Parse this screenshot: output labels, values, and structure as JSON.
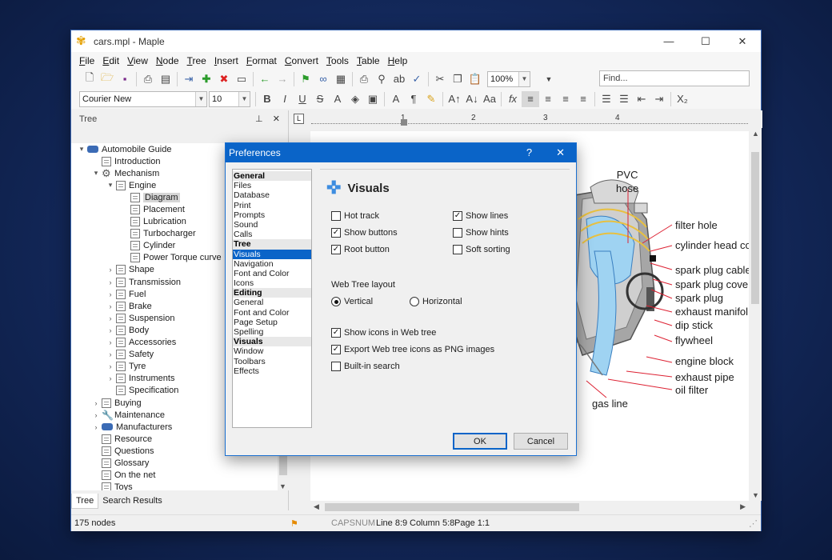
{
  "window": {
    "title": "cars.mpl - Maple"
  },
  "menu": [
    "File",
    "Edit",
    "View",
    "Node",
    "Tree",
    "Insert",
    "Format",
    "Convert",
    "Tools",
    "Table",
    "Help"
  ],
  "toolbar": {
    "zoom": "100%",
    "find_placeholder": "Find...",
    "font": "Courier New",
    "font_size": "10"
  },
  "tree_panel": {
    "title": "Tree",
    "rows": [
      {
        "label": "Automobile Guide",
        "indent": 0,
        "exp": "▾",
        "icon": "car"
      },
      {
        "label": "Introduction",
        "indent": 1,
        "exp": "",
        "icon": "page"
      },
      {
        "label": "Mechanism",
        "indent": 1,
        "exp": "▾",
        "icon": "gear"
      },
      {
        "label": "Engine",
        "indent": 2,
        "exp": "▾",
        "icon": "page"
      },
      {
        "label": "Diagram",
        "indent": 3,
        "exp": "",
        "icon": "page",
        "selected": true
      },
      {
        "label": "Placement",
        "indent": 3,
        "exp": "",
        "icon": "page"
      },
      {
        "label": "Lubrication",
        "indent": 3,
        "exp": "",
        "icon": "page"
      },
      {
        "label": "Turbocharger",
        "indent": 3,
        "exp": "",
        "icon": "page"
      },
      {
        "label": "Cylinder",
        "indent": 3,
        "exp": "",
        "icon": "page"
      },
      {
        "label": "Power Torque curve",
        "indent": 3,
        "exp": "",
        "icon": "page"
      },
      {
        "label": "Shape",
        "indent": 2,
        "exp": "›",
        "icon": "page"
      },
      {
        "label": "Transmission",
        "indent": 2,
        "exp": "›",
        "icon": "page"
      },
      {
        "label": "Fuel",
        "indent": 2,
        "exp": "›",
        "icon": "page"
      },
      {
        "label": "Brake",
        "indent": 2,
        "exp": "›",
        "icon": "page"
      },
      {
        "label": "Suspension",
        "indent": 2,
        "exp": "›",
        "icon": "page"
      },
      {
        "label": "Body",
        "indent": 2,
        "exp": "›",
        "icon": "page"
      },
      {
        "label": "Accessories",
        "indent": 2,
        "exp": "›",
        "icon": "page"
      },
      {
        "label": "Safety",
        "indent": 2,
        "exp": "›",
        "icon": "page"
      },
      {
        "label": "Tyre",
        "indent": 2,
        "exp": "›",
        "icon": "page"
      },
      {
        "label": "Instruments",
        "indent": 2,
        "exp": "›",
        "icon": "page"
      },
      {
        "label": "Specification",
        "indent": 2,
        "exp": "",
        "icon": "page"
      },
      {
        "label": "Buying",
        "indent": 1,
        "exp": "›",
        "icon": "page"
      },
      {
        "label": "Maintenance",
        "indent": 1,
        "exp": "›",
        "icon": "wrench"
      },
      {
        "label": "Manufacturers",
        "indent": 1,
        "exp": "›",
        "icon": "car"
      },
      {
        "label": "Resource",
        "indent": 1,
        "exp": "",
        "icon": "page"
      },
      {
        "label": "Questions",
        "indent": 1,
        "exp": "",
        "icon": "page"
      },
      {
        "label": "Glossary",
        "indent": 1,
        "exp": "",
        "icon": "page"
      },
      {
        "label": "On the net",
        "indent": 1,
        "exp": "",
        "icon": "page"
      },
      {
        "label": "Toys",
        "indent": 1,
        "exp": "",
        "icon": "page"
      }
    ],
    "tabs": [
      "Tree",
      "Search Results"
    ]
  },
  "ruler": {
    "marks": [
      "1",
      "2",
      "3",
      "4"
    ]
  },
  "diagram": {
    "labels": [
      "PVC",
      "hose",
      "filter hole",
      "cylinder head co",
      "spark plug cable",
      "spark plug cove",
      "spark plug",
      "exhaust manifol",
      "dip stick",
      "flywheel",
      "engine block",
      "exhaust pipe",
      "oil filter",
      "gas line"
    ]
  },
  "status": {
    "nodes": "175 nodes",
    "caps": "CAPS",
    "num": "NUM",
    "line": "Line 8:9",
    "column": "Column 5:8",
    "page": "Page 1:1"
  },
  "dialog": {
    "title": "Preferences",
    "help": "?",
    "close": "✕",
    "categories": [
      {
        "label": "General",
        "hdr": true
      },
      {
        "label": "Files"
      },
      {
        "label": "Database"
      },
      {
        "label": "Print"
      },
      {
        "label": "Prompts"
      },
      {
        "label": "Sound"
      },
      {
        "label": "Calls"
      },
      {
        "label": "Tree",
        "hdr": true
      },
      {
        "label": "Visuals",
        "sel": true
      },
      {
        "label": "Navigation"
      },
      {
        "label": "Font and Color"
      },
      {
        "label": "Icons"
      },
      {
        "label": "Editing",
        "hdr": true
      },
      {
        "label": "General"
      },
      {
        "label": "Font and Color"
      },
      {
        "label": "Page Setup"
      },
      {
        "label": "Spelling"
      },
      {
        "label": "Visuals",
        "hdr": true
      },
      {
        "label": "Window"
      },
      {
        "label": "Toolbars"
      },
      {
        "label": "Effects"
      }
    ],
    "section_title": "Visuals",
    "hot_track": "Hot track",
    "show_buttons": "Show buttons",
    "root_button": "Root button",
    "show_lines": "Show lines",
    "show_hints": "Show hints",
    "soft_sorting": "Soft sorting",
    "web_tree_layout": "Web Tree layout",
    "vertical": "Vertical",
    "horizontal": "Horizontal",
    "show_icons_web": "Show icons in Web tree",
    "export_png": "Export Web tree icons as PNG images",
    "builtin_search": "Built-in search",
    "ok": "OK",
    "cancel": "Cancel"
  }
}
